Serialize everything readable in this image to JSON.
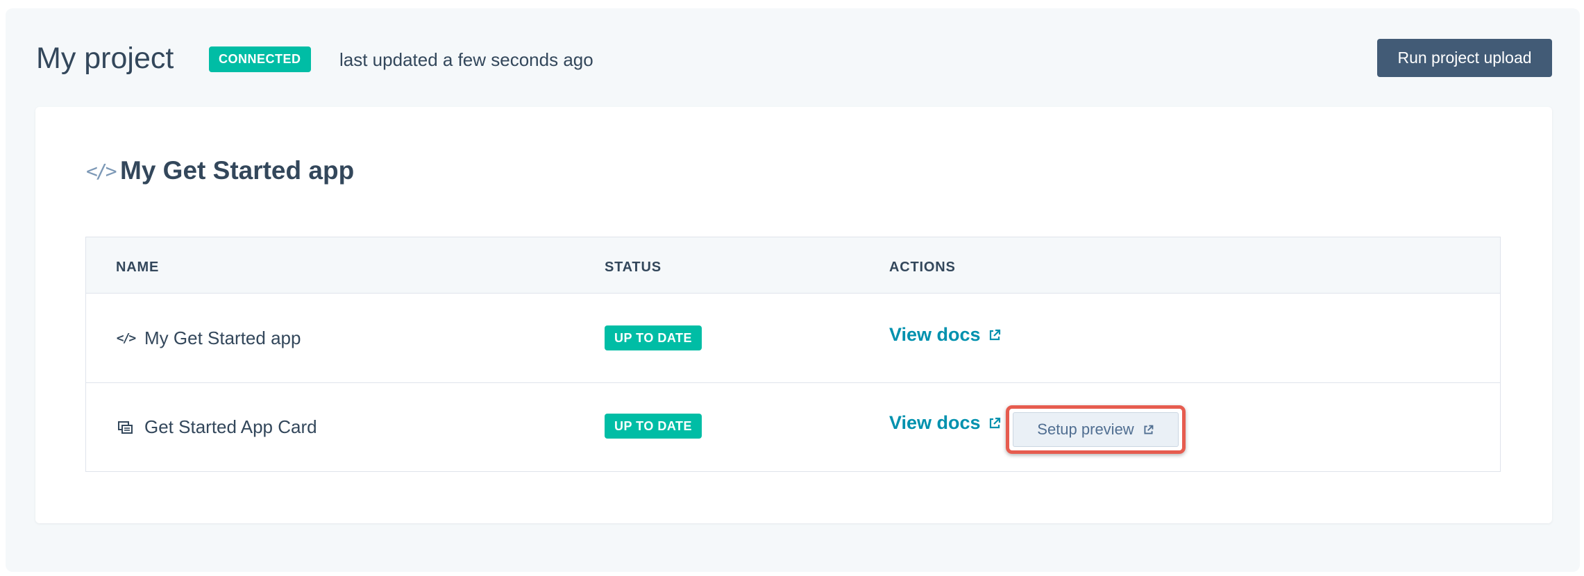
{
  "header": {
    "title": "My project",
    "status_badge": "CONNECTED",
    "last_updated": "last updated a few seconds ago",
    "run_upload_label": "Run project upload"
  },
  "app": {
    "title": "My Get Started app",
    "icon": "code-icon"
  },
  "table": {
    "columns": [
      "NAME",
      "STATUS",
      "ACTIONS"
    ],
    "rows": [
      {
        "name": "My Get Started app",
        "icon": "code-icon",
        "status": "UP TO DATE",
        "action": "View docs"
      },
      {
        "name": "Get Started App Card",
        "icon": "cards-icon",
        "status": "UP TO DATE",
        "action": "View docs",
        "secondary_action": "Setup preview"
      }
    ]
  },
  "colors": {
    "accent": "#00bda5",
    "primary_button": "#425b76",
    "link": "#0091ae",
    "highlight": "#e65c4f"
  }
}
